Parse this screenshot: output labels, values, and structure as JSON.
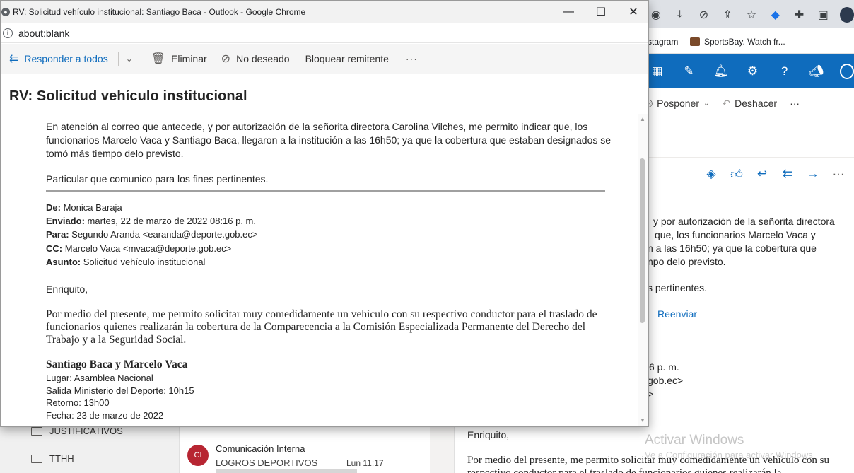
{
  "background": {
    "bookmarks": {
      "instagram": "stagram",
      "sportsbay": "SportsBay. Watch fr..."
    },
    "ribbon_actions": {
      "posponer": "Posponer",
      "deshacer": "Deshacer"
    },
    "reading_lines": [
      "y por autorización de la señorita directora",
      "que, los funcionarios Marcelo Vaca y",
      "n a las 16h50; ya que la cobertura que",
      "npo delo previsto.",
      "s pertinentes."
    ],
    "reenviar": "Reenviar",
    "header_lines": [
      "6 p. m.",
      "gob.ec>",
      ">"
    ],
    "folders": [
      "JUSTIFICATIVOS",
      "TTHH"
    ],
    "list_item": {
      "avatar": "CI",
      "sender": "Comunicación Interna",
      "subject": "LOGROS DEPORTIVOS",
      "time": "Lun 11:17"
    },
    "mail_greeting": "Enriquito,",
    "mail_body": "Por medio del presente, me permito solicitar muy comedidamente un vehículo con su respectivo conductor para el traslado de funcionarios quienes realizarán la",
    "watermark": {
      "title": "Activar Windows",
      "subtitle": "Ve a Configuración para activar Windows."
    }
  },
  "popup": {
    "window_title": "RV: Solicitud vehículo institucional: Santiago Baca - Outlook - Google Chrome",
    "address": "about:blank",
    "toolbar": {
      "reply_all": "Responder a todos",
      "delete": "Eliminar",
      "junk": "No deseado",
      "block": "Bloquear remitente",
      "more": "···"
    },
    "subject": "RV: Solicitud vehículo institucional",
    "body": {
      "p1": "En atención al correo que antecede, y por autorización de la señorita directora Carolina Vilches, me permito indicar que, los funcionarios Marcelo Vaca y Santiago Baca, llegaron a la institución a las 16h50; ya que la cobertura que estaban designados se tomó más tiempo delo previsto.",
      "p2": "Particular que comunico para los fines pertinentes.",
      "from_label": "De:",
      "from": "Monica Baraja",
      "sent_label": "Enviado:",
      "sent": "martes, 22 de marzo de 2022 08:16 p. m.",
      "to_label": "Para:",
      "to": "Segundo Aranda <earanda@deporte.gob.ec>",
      "cc_label": "CC:",
      "cc": "Marcelo Vaca <mvaca@deporte.gob.ec>",
      "subject_label": "Asunto:",
      "subject_value": "Solicitud vehículo institucional",
      "greeting": "Enriquito,",
      "request": "Por medio del presente, me permito solicitar muy comedidamente un vehículo con su respectivo conductor para el traslado de funcionarios quienes realizarán la cobertura de la Comparecencia a la Comisión Especializada Permanente del Derecho del Trabajo y a la Seguridad Social.",
      "names": "Santiago Baca y Marcelo Vaca",
      "place": "Lugar:  Asamblea Nacional",
      "departure": "Salida Ministerio del Deporte: 10h15",
      "return": "Retorno: 13h00",
      "date": "Fecha: 23 de marzo de 2022"
    }
  }
}
